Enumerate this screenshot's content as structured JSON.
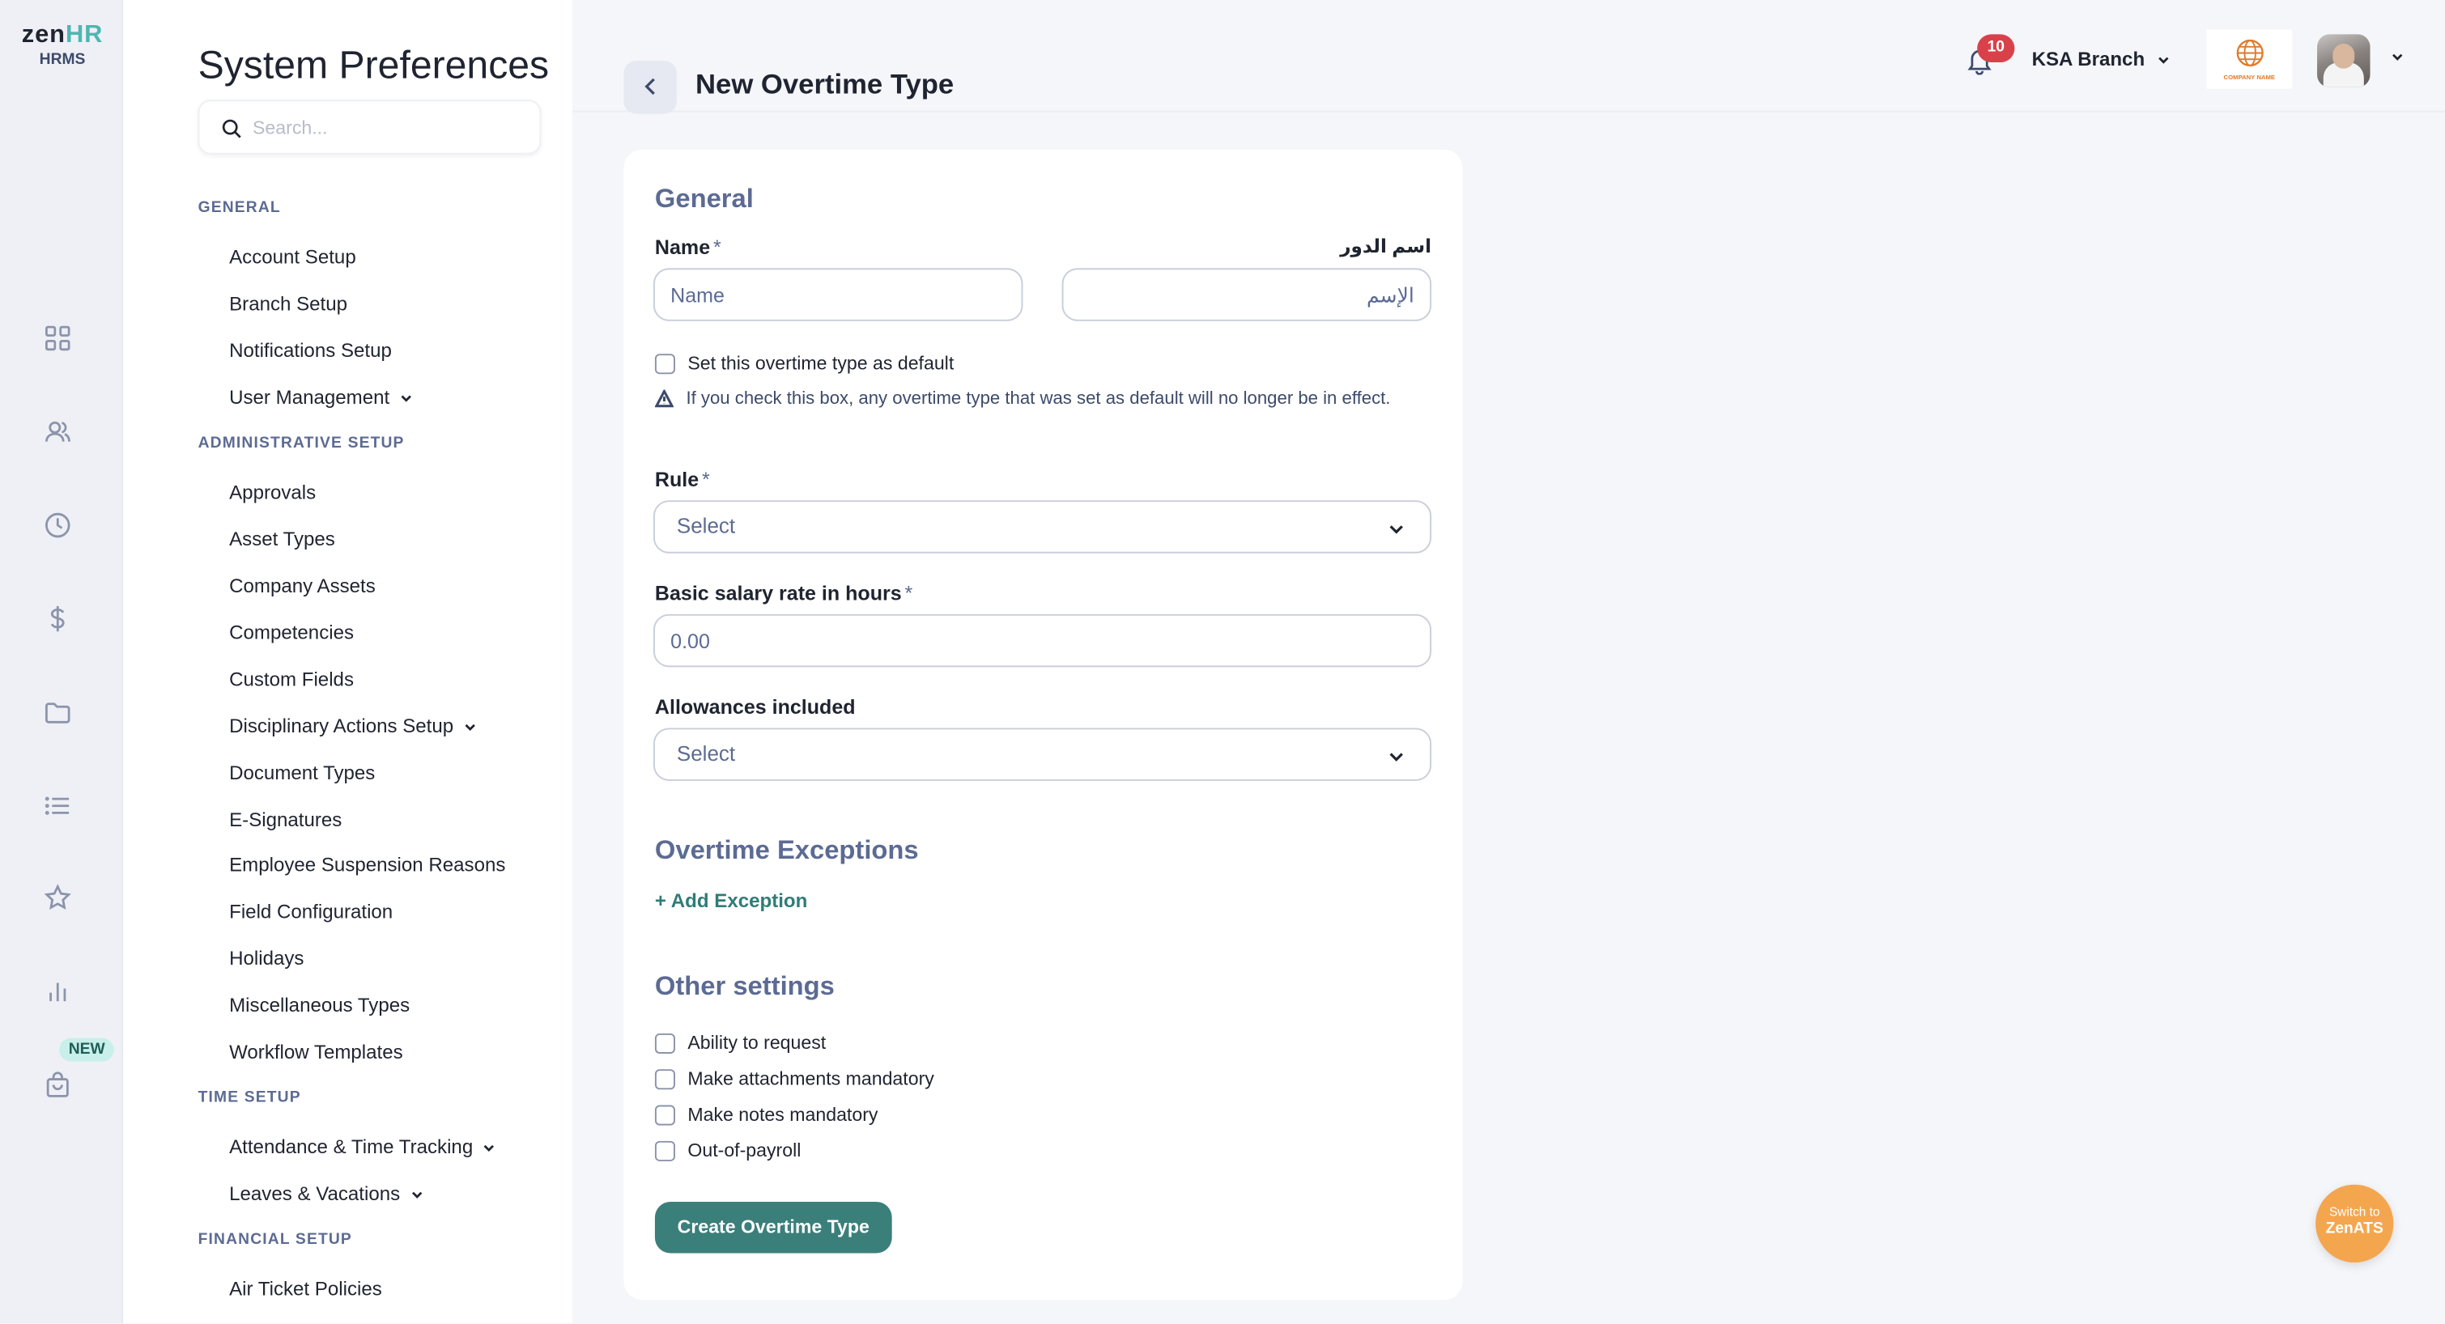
{
  "brand": {
    "logo_text_zen": "zen",
    "logo_text_hr": "HR",
    "product": "HRMS"
  },
  "rail": {
    "new_badge": "NEW",
    "icons": [
      "dashboard-icon",
      "people-icon",
      "clock-icon",
      "dollar-icon",
      "folder-icon",
      "list-icon",
      "star-icon",
      "chart-icon",
      "bag-icon"
    ]
  },
  "sidebar": {
    "title": "System Preferences",
    "search_placeholder": "Search...",
    "sections": [
      {
        "title": "GENERAL",
        "items": [
          "Account Setup",
          "Branch Setup",
          "Notifications Setup",
          "User Management"
        ]
      },
      {
        "title": "ADMINISTRATIVE SETUP",
        "items": [
          "Approvals",
          "Asset Types",
          "Company Assets",
          "Competencies",
          "Custom Fields",
          "Disciplinary Actions Setup",
          "Document Types",
          "E-Signatures",
          "Employee Suspension Reasons",
          "Field Configuration",
          "Holidays",
          "Miscellaneous Types",
          "Workflow Templates"
        ]
      },
      {
        "title": "TIME SETUP",
        "items": [
          "Attendance & Time Tracking",
          "Leaves & Vacations"
        ]
      },
      {
        "title": "FINANCIAL SETUP",
        "items": [
          "Air Ticket Policies"
        ]
      }
    ]
  },
  "header": {
    "page_title": "New Overtime Type",
    "notification_count": "10",
    "branch": "KSA Branch",
    "company_logo_text": "COMPANY NAME"
  },
  "form": {
    "general_title": "General",
    "name_label": "Name",
    "required_mark": "*",
    "name_placeholder": "Name",
    "arabic_label": "اسم الدور",
    "arabic_placeholder": "الإسم",
    "default_checkbox": "Set this overtime type as default",
    "default_warning": "If you check this box, any overtime type that was set as default will no longer be in effect.",
    "rule_label": "Rule",
    "rule_value": "Select",
    "salary_label": "Basic salary rate in hours",
    "salary_placeholder": "0.00",
    "allowances_label": "Allowances included",
    "allowances_value": "Select",
    "exceptions_title": "Overtime Exceptions",
    "add_exception": "+ Add Exception",
    "other_title": "Other settings",
    "other_options": [
      "Ability to request",
      "Make attachments mandatory",
      "Make notes mandatory",
      "Out-of-payroll"
    ],
    "submit_label": "Create Overtime Type"
  },
  "switch_ats": {
    "line1": "Switch to",
    "line2": "ZenATS"
  },
  "colors": {
    "accent": "#3b7f7a",
    "section_heading": "#5c6b93",
    "notification": "#d9414a",
    "switch_ats": "#f4a64f"
  }
}
